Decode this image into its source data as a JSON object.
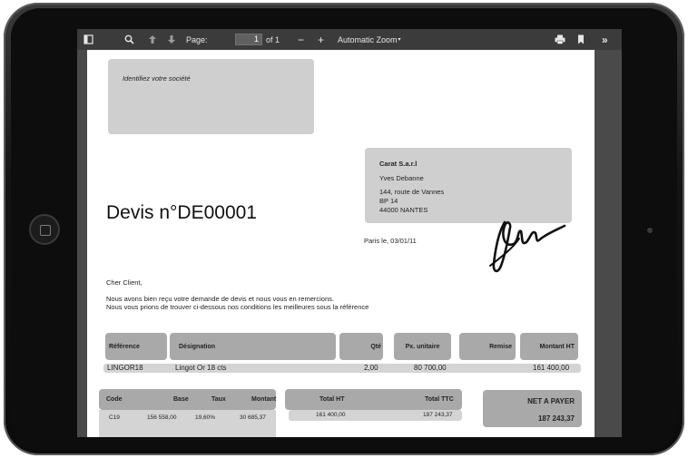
{
  "toolbar": {
    "page_label": "Page:",
    "page_value": "1",
    "page_of": "of 1",
    "zoom_minus": "−",
    "zoom_plus": "+",
    "zoom_label": "Automatic Zoom"
  },
  "company_placeholder": "Identifiez votre société",
  "recipient": {
    "name": "Carat S.a.r.l",
    "person": "Yves Debanne",
    "street": "144, route de Vannes",
    "bp": "BP 14",
    "city": "44000 NANTES"
  },
  "quote_title": "Devis n°DE00001",
  "place_date": "Paris le,  03/01/11",
  "greeting": "Cher Client,",
  "body_line1": "Nous avons bien reçu votre demande de devis et nous vous en remercions.",
  "body_line2": "Nous vous prions de trouver ci-dessous nos conditions les meilleures sous la référence",
  "items_table": {
    "headers": {
      "reference": "Référence",
      "designation": "Désignation",
      "qty": "Qté",
      "unit_price": "Px. unitaire",
      "discount": "Remise",
      "amount": "Montant HT"
    },
    "row": {
      "reference": "LINGOR18",
      "designation": "Lingot Or 18 cts",
      "qty": "2,00",
      "unit_price": "80 700,00",
      "amount": "161 400,00"
    }
  },
  "tax_table": {
    "headers": {
      "code": "Code",
      "base": "Base",
      "rate": "Taux",
      "amount": "Montant"
    },
    "row": {
      "code": "C19",
      "base": "156 558,00",
      "rate": "19,60%",
      "amount": "30 685,37"
    }
  },
  "totals_table": {
    "headers": {
      "total_ht": "Total HT",
      "total_ttc": "Total TTC"
    },
    "row": {
      "total_ht": "161 400,00",
      "total_ttc": "187 243,37"
    }
  },
  "net_to_pay": {
    "label": "NET A PAYER",
    "value": "187 243,37"
  }
}
